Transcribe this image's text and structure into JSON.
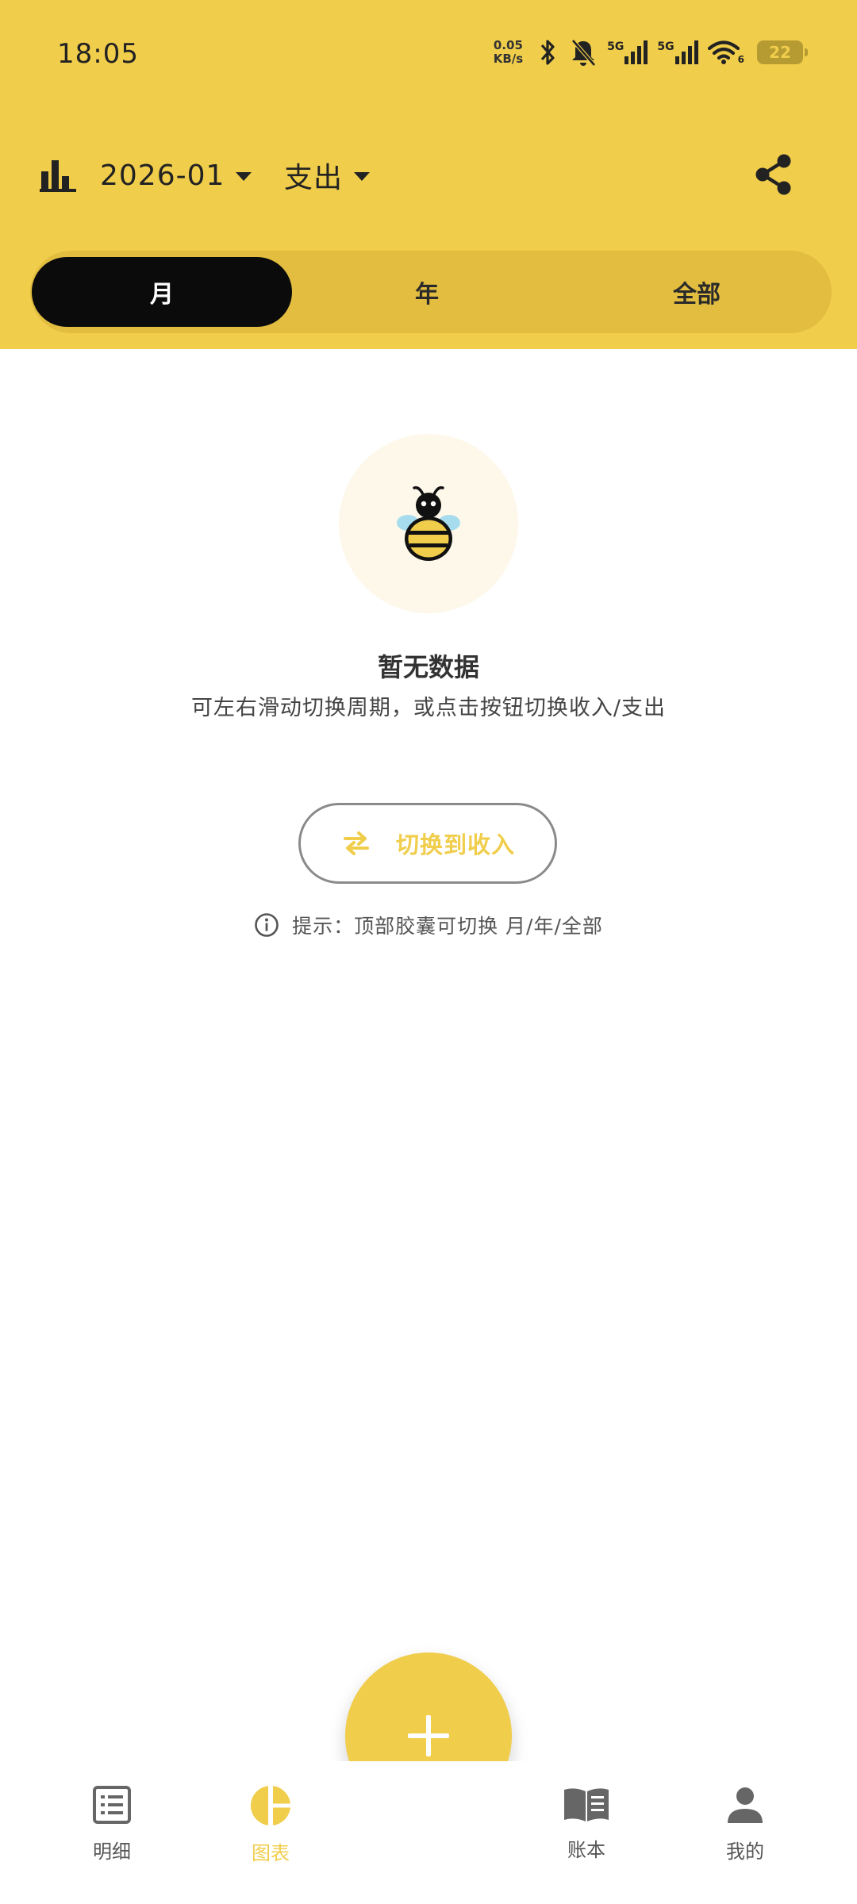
{
  "status_bar": {
    "time": "18:05",
    "net_speed_value": "0.05",
    "net_speed_unit": "KB/s",
    "sim1_label": "5G",
    "sim2_label": "5G",
    "wifi_label": "6",
    "battery_level": "22"
  },
  "toolbar": {
    "month_label": "2026-01",
    "type_label": "支出"
  },
  "period_tabs": [
    {
      "label": "月",
      "active": true
    },
    {
      "label": "年",
      "active": false
    },
    {
      "label": "全部",
      "active": false
    }
  ],
  "empty_state": {
    "title": "暂无数据",
    "subtitle": "可左右滑动切换周期，或点击按钮切换收入/支出",
    "button_label": "切换到收入",
    "hint": "提示：顶部胶囊可切换 月/年/全部"
  },
  "bottom_nav": {
    "items": [
      {
        "label": "明细",
        "icon": "list-icon",
        "active": false
      },
      {
        "label": "图表",
        "icon": "pie-chart-icon",
        "active": true
      },
      {
        "label": "账本",
        "icon": "book-icon",
        "active": false
      },
      {
        "label": "我的",
        "icon": "person-icon",
        "active": false
      }
    ]
  },
  "colors": {
    "accent": "#f0cd4b",
    "segment_track": "#e2bd40",
    "active_segment": "#0b0b0b"
  }
}
